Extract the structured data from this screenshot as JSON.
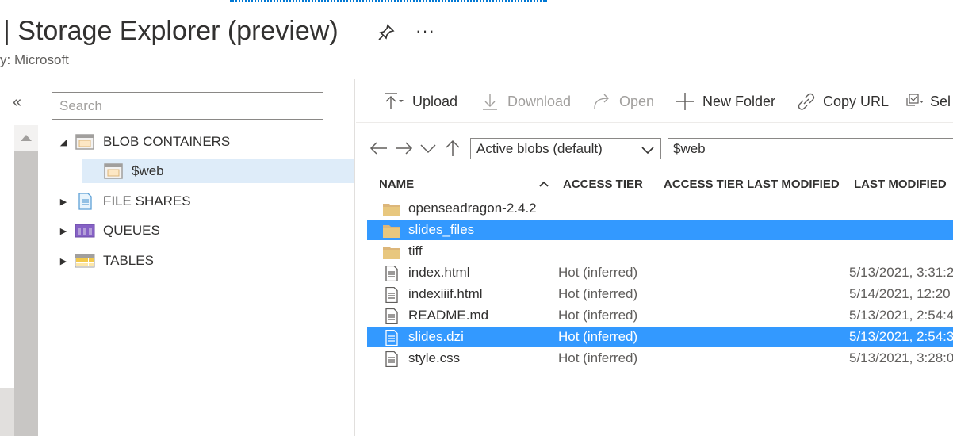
{
  "header": {
    "title": "| Storage Explorer (preview)",
    "subtitle": "y: Microsoft",
    "more_label": "···"
  },
  "left_panel": {
    "collapse_label": "«",
    "search_placeholder": "Search",
    "tree": [
      {
        "label": "BLOB CONTAINERS",
        "icon": "blob-container-icon",
        "expanded": true
      },
      {
        "label": "$web",
        "icon": "container-icon",
        "selected": true
      },
      {
        "label": "FILE SHARES",
        "icon": "file-share-icon",
        "expanded": false
      },
      {
        "label": "QUEUES",
        "icon": "queue-icon",
        "expanded": false
      },
      {
        "label": "TABLES",
        "icon": "table-icon",
        "expanded": false
      }
    ]
  },
  "toolbar": {
    "upload": "Upload",
    "download": "Download",
    "open": "Open",
    "new_folder": "New Folder",
    "copy_url": "Copy URL",
    "select": "Sel"
  },
  "navigation": {
    "view_filter": "Active blobs (default)",
    "path": "$web"
  },
  "table": {
    "columns": [
      "NAME",
      "ACCESS TIER",
      "ACCESS TIER LAST MODIFIED",
      "LAST MODIFIED"
    ],
    "rows": [
      {
        "name": "openseadragon-2.4.2",
        "type": "folder",
        "tier": "",
        "modified": "",
        "selected": false
      },
      {
        "name": "slides_files",
        "type": "folder",
        "tier": "",
        "modified": "",
        "selected": true
      },
      {
        "name": "tiff",
        "type": "folder",
        "tier": "",
        "modified": "",
        "selected": false
      },
      {
        "name": "index.html",
        "type": "file",
        "tier": "Hot (inferred)",
        "modified": "5/13/2021, 3:31:2",
        "selected": false
      },
      {
        "name": "indexiiif.html",
        "type": "file",
        "tier": "Hot (inferred)",
        "modified": "5/14/2021, 12:20",
        "selected": false
      },
      {
        "name": "README.md",
        "type": "file",
        "tier": "Hot (inferred)",
        "modified": "5/13/2021, 2:54:4",
        "selected": false
      },
      {
        "name": "slides.dzi",
        "type": "file",
        "tier": "Hot (inferred)",
        "modified": "5/13/2021, 2:54:3",
        "selected": true
      },
      {
        "name": "style.css",
        "type": "file",
        "tier": "Hot (inferred)",
        "modified": "5/13/2021, 3:28:0",
        "selected": false
      }
    ]
  },
  "colors": {
    "accent": "#0078d4",
    "selection": "#3399ff",
    "tree_selection": "#deecf9",
    "folder": "#dcb67a"
  }
}
